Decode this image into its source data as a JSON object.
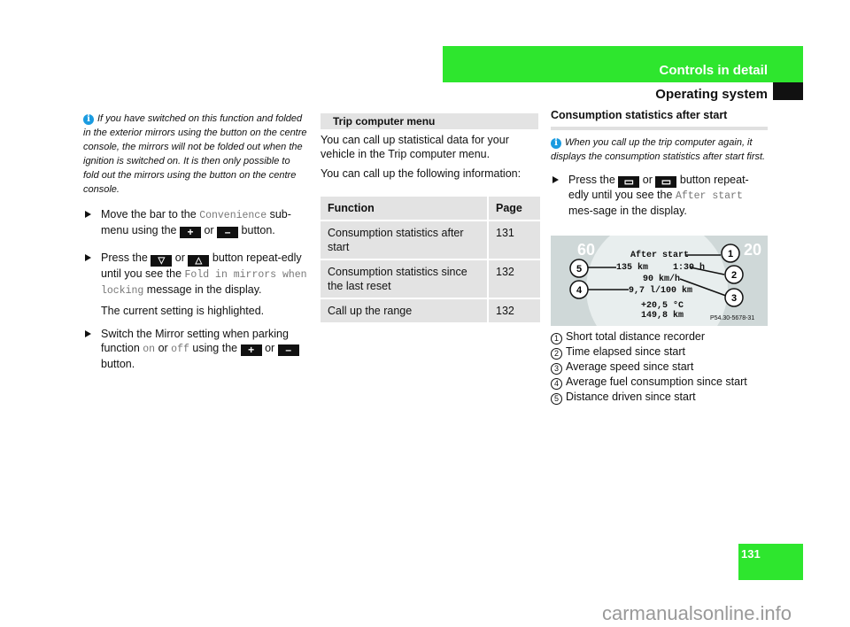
{
  "header": {
    "chapter": "Controls in detail",
    "section": "Operating system"
  },
  "left": {
    "note": "If you have switched on this function and folded in the exterior mirrors using the button on the centre console, the mirrors will not be folded out when the ignition is switched on. It is then only possible to fold out the mirrors using the button on the centre console.",
    "step1": {
      "a": "Move the bar to the",
      "menu": "Convenience",
      "b": "sub-menu using the",
      "or": "or",
      "c": "button."
    },
    "step2": {
      "a": "Press the",
      "or": "or",
      "b": "button repeat-edly until you see the",
      "msg": "Fold in mirrors when locking",
      "c": "message in the display."
    },
    "step2_note": "The current setting is highlighted.",
    "step3": {
      "a": "Switch the Mirror setting when parking function",
      "on": "on",
      "or1": "or",
      "off": "off",
      "b": "using the",
      "or2": "or",
      "c": "button."
    },
    "keys": {
      "plus": "+",
      "minus": "–",
      "down": "▽",
      "up": "△"
    }
  },
  "middle": {
    "title": "Trip computer menu",
    "p1": "You can call up statistical data for your vehicle in the Trip computer menu.",
    "p2": "You can call up the following information:",
    "table": {
      "headers": [
        "Function",
        "Page"
      ],
      "rows": [
        [
          "Consumption statistics after start",
          "131"
        ],
        [
          "Consumption statistics since the last reset",
          "132"
        ],
        [
          "Call up the range",
          "132"
        ]
      ]
    }
  },
  "right": {
    "title": "Consumption statistics after start",
    "note": "When you call up the trip computer again, it displays the consumption statistics after start first.",
    "step": {
      "a": "Press the",
      "or": "or",
      "b": "button repeat-edly until you see the",
      "msg": "After start",
      "c": "mes-sage in the display."
    },
    "display": {
      "title": "After start",
      "distance": "135 km",
      "time": "1:30 h",
      "speed": "90 km/h",
      "consumption": "9,7 l/100 km",
      "temp": "+20,5 °C",
      "odo": "149,8 km",
      "code": "P54.30-5678-31",
      "dial": [
        "60",
        "20"
      ]
    },
    "legend": [
      {
        "n": "1",
        "t": "Short total distance recorder"
      },
      {
        "n": "2",
        "t": "Time elapsed since start"
      },
      {
        "n": "3",
        "t": "Average speed since start"
      },
      {
        "n": "4",
        "t": "Average fuel consumption since start"
      },
      {
        "n": "5",
        "t": "Distance driven since start"
      }
    ]
  },
  "page_number": "131",
  "watermark": "carmanualsonline.info",
  "colors": {
    "accent": "#2ee62e",
    "info": "#1a9be0",
    "panel": "#e3e3e3"
  }
}
